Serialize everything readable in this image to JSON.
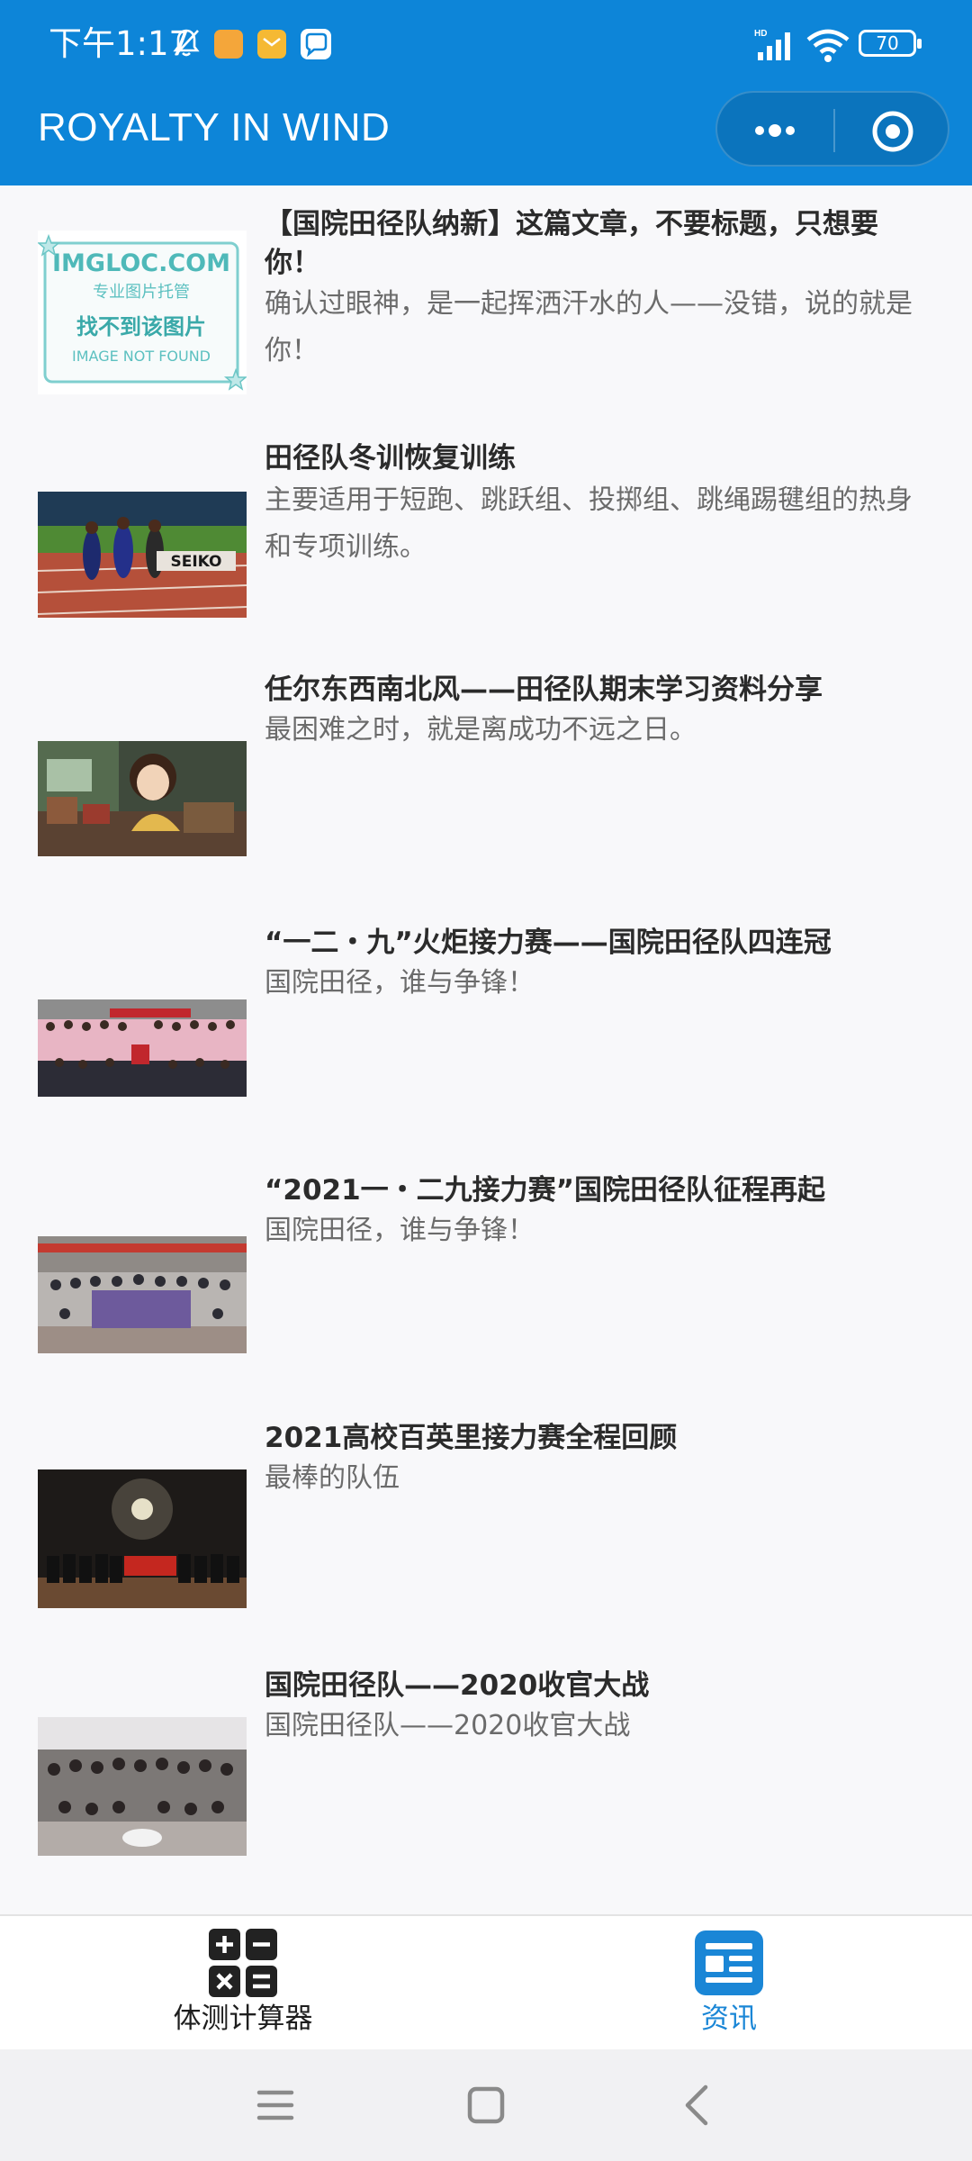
{
  "status_bar": {
    "time": "下午1:17",
    "battery": "70",
    "icons": [
      "bell-muted-icon",
      "app-notification-icon",
      "mail-icon",
      "chat-icon",
      "hd-signal-icon",
      "wifi-icon",
      "battery-icon"
    ]
  },
  "header": {
    "title": "ROYALTY IN WIND",
    "more_icon": "more-dots-icon",
    "close_icon": "target-close-icon",
    "color": "#0d85d8"
  },
  "articles": [
    {
      "title": "【国院田径队纳新】这篇文章，不要标题，只想要你！",
      "desc": "确认过眼神，是一起挥洒汗水的人——没错，说的就是你！",
      "thumb_text": [
        "IMGLOC.COM",
        "专业图片托管",
        "找不到该图片",
        "IMAGE NOT FOUND"
      ]
    },
    {
      "title": "田径队冬训恢复训练",
      "desc": "主要适用于短跑、跳跃组、投掷组、跳绳踢毽组的热身和专项训练。",
      "thumb_text": [
        "SEIKO"
      ]
    },
    {
      "title": "任尔东西南北风——田径队期末学习资料分享",
      "desc": "最困难之时，就是离成功不远之日。",
      "thumb_text": []
    },
    {
      "title": "“一二・九”火炬接力赛——国院田径队四连冠",
      "desc": "国院田径，谁与争锋！",
      "thumb_text": []
    },
    {
      "title": "“2021一・二九接力赛”国院田径队征程再起",
      "desc": "国院田径，谁与争锋！",
      "thumb_text": []
    },
    {
      "title": "2021高校百英里接力赛全程回顾",
      "desc": "最棒的队伍",
      "thumb_text": []
    },
    {
      "title": "国院田径队——2020收官大战",
      "desc": "国院田径队——2020收官大战",
      "thumb_text": []
    }
  ],
  "tabbar": {
    "tabs": [
      {
        "label": "体测计算器",
        "icon": "calculator-icon",
        "active": false
      },
      {
        "label": "资讯",
        "icon": "news-icon",
        "active": true
      }
    ],
    "active_color": "#1a86d6"
  },
  "system_nav": {
    "icons": [
      "menu-icon",
      "home-icon",
      "back-icon"
    ]
  }
}
